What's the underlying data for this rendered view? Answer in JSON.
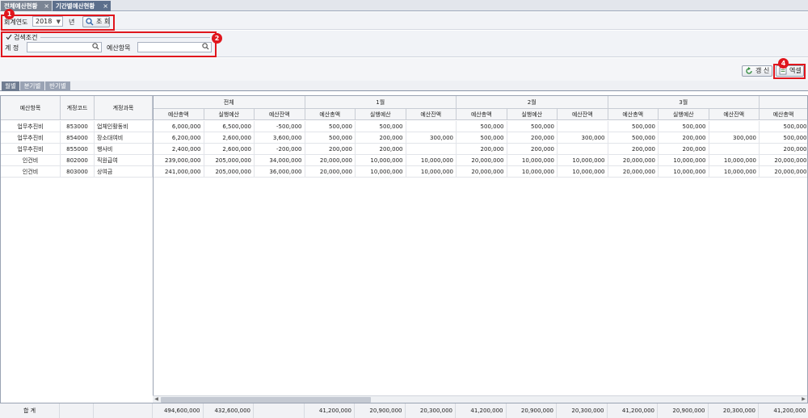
{
  "tabs": [
    {
      "label": "전체예산현황",
      "close": "×"
    },
    {
      "label": "기간별예산현황",
      "close": "×"
    }
  ],
  "search": {
    "year_label": "회계연도",
    "year_value": "2018",
    "year_unit": "년",
    "query_button": "조 회",
    "group_title": "검색조건",
    "account_label": "계 정",
    "budget_item_label": "예산항목"
  },
  "toolbar": {
    "refresh_button": "갱 신",
    "excel_button": "엑셀"
  },
  "badges": [
    "1",
    "2",
    "4"
  ],
  "subtabs": [
    "월별",
    "분기별",
    "반기별"
  ],
  "grid": {
    "fixed_headers": [
      "예산항목",
      "계정코드",
      "계정과목"
    ],
    "groups": [
      "전체",
      "1월",
      "2월",
      "3월"
    ],
    "sub_headers": [
      "예산총액",
      "실행예산",
      "예산잔액"
    ],
    "rows": [
      [
        "업무추진비",
        "853000",
        "업체인활동비",
        "6,000,000",
        "6,500,000",
        "-500,000",
        "500,000",
        "500,000",
        "",
        "500,000",
        "500,000",
        "",
        "500,000",
        "500,000",
        "",
        "500,000"
      ],
      [
        "업무추진비",
        "854000",
        "장소대여비",
        "6,200,000",
        "2,600,000",
        "3,600,000",
        "500,000",
        "200,000",
        "300,000",
        "500,000",
        "200,000",
        "300,000",
        "500,000",
        "200,000",
        "300,000",
        "500,000"
      ],
      [
        "업무추진비",
        "855000",
        "행사비",
        "2,400,000",
        "2,600,000",
        "-200,000",
        "200,000",
        "200,000",
        "",
        "200,000",
        "200,000",
        "",
        "200,000",
        "200,000",
        "",
        "200,000"
      ],
      [
        "인건비",
        "802000",
        "직원급여",
        "239,000,000",
        "205,000,000",
        "34,000,000",
        "20,000,000",
        "10,000,000",
        "10,000,000",
        "20,000,000",
        "10,000,000",
        "10,000,000",
        "20,000,000",
        "10,000,000",
        "10,000,000",
        "20,000,000"
      ],
      [
        "인건비",
        "803000",
        "상여금",
        "241,000,000",
        "205,000,000",
        "36,000,000",
        "20,000,000",
        "10,000,000",
        "10,000,000",
        "20,000,000",
        "10,000,000",
        "10,000,000",
        "20,000,000",
        "10,000,000",
        "10,000,000",
        "20,000,000"
      ]
    ],
    "total_label": "합 계",
    "totals": [
      "494,600,000",
      "432,600,000",
      "",
      "41,200,000",
      "20,900,000",
      "20,300,000",
      "41,200,000",
      "20,900,000",
      "20,300,000",
      "41,200,000",
      "20,900,000",
      "20,300,000",
      "41,200,000"
    ]
  }
}
